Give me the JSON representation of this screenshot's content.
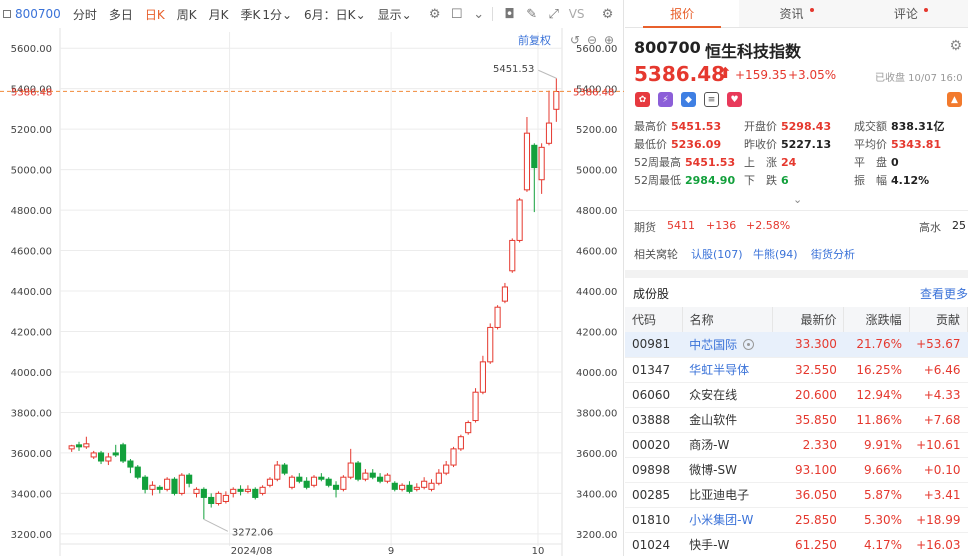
{
  "toolbar": {
    "code": "800700",
    "periods": [
      "分时",
      "多日",
      "日K",
      "周K",
      "月K",
      "季K"
    ],
    "active_period": "日K",
    "minute_select": "1分",
    "range_select": "6月：日K",
    "display_select": "显示",
    "vs_label": "VS"
  },
  "chart": {
    "adjust_label": "前复权",
    "price_line_label": "5386.48",
    "high_annotation": "5451.53",
    "low_annotation": "3272.06",
    "y_ticks": [
      "5600.00",
      "5400.00",
      "5200.00",
      "5000.00",
      "4800.00",
      "4600.00",
      "4400.00",
      "4200.00",
      "4000.00",
      "3800.00",
      "3600.00",
      "3400.00",
      "3200.00"
    ],
    "x_ticks": [
      "2024/08",
      "9",
      "10"
    ],
    "colors": {
      "up": "#e5382e",
      "down": "#13a03c",
      "price_line": "#f08a3a",
      "grid": "#ececec"
    }
  },
  "chart_data": {
    "type": "candlestick",
    "ylim": [
      3140,
      5680
    ],
    "y_ticks": [
      3200,
      3400,
      3600,
      3800,
      4000,
      4200,
      4400,
      4600,
      4800,
      5000,
      5200,
      5400,
      5600
    ],
    "x_ticks": [
      "2024/08",
      "9",
      "10"
    ],
    "last_price": 5386.48,
    "high": 5451.53,
    "low": 3272.06,
    "candles": [
      [
        3620,
        3635,
        3640,
        3605
      ],
      [
        3640,
        3630,
        3655,
        3610
      ],
      [
        3630,
        3645,
        3680,
        3620
      ],
      [
        3580,
        3600,
        3610,
        3570
      ],
      [
        3600,
        3560,
        3610,
        3545
      ],
      [
        3560,
        3580,
        3600,
        3540
      ],
      [
        3600,
        3590,
        3640,
        3580
      ],
      [
        3640,
        3560,
        3650,
        3550
      ],
      [
        3560,
        3530,
        3570,
        3500
      ],
      [
        3530,
        3480,
        3540,
        3470
      ],
      [
        3480,
        3420,
        3490,
        3400
      ],
      [
        3420,
        3440,
        3460,
        3390
      ],
      [
        3430,
        3420,
        3440,
        3400
      ],
      [
        3420,
        3470,
        3480,
        3410
      ],
      [
        3470,
        3400,
        3480,
        3390
      ],
      [
        3400,
        3490,
        3500,
        3390
      ],
      [
        3490,
        3450,
        3500,
        3430
      ],
      [
        3400,
        3420,
        3430,
        3380
      ],
      [
        3420,
        3380,
        3430,
        3272
      ],
      [
        3380,
        3350,
        3400,
        3330
      ],
      [
        3350,
        3400,
        3410,
        3340
      ],
      [
        3360,
        3390,
        3410,
        3350
      ],
      [
        3400,
        3420,
        3430,
        3380
      ],
      [
        3420,
        3410,
        3440,
        3390
      ],
      [
        3410,
        3420,
        3440,
        3400
      ],
      [
        3420,
        3380,
        3430,
        3370
      ],
      [
        3400,
        3430,
        3440,
        3390
      ],
      [
        3440,
        3470,
        3480,
        3430
      ],
      [
        3470,
        3540,
        3560,
        3460
      ],
      [
        3540,
        3500,
        3550,
        3490
      ],
      [
        3430,
        3480,
        3490,
        3420
      ],
      [
        3480,
        3460,
        3500,
        3450
      ],
      [
        3460,
        3430,
        3480,
        3420
      ],
      [
        3440,
        3480,
        3490,
        3430
      ],
      [
        3480,
        3470,
        3500,
        3460
      ],
      [
        3470,
        3440,
        3480,
        3430
      ],
      [
        3440,
        3420,
        3460,
        3380
      ],
      [
        3420,
        3480,
        3490,
        3410
      ],
      [
        3480,
        3550,
        3620,
        3470
      ],
      [
        3550,
        3470,
        3560,
        3460
      ],
      [
        3470,
        3500,
        3520,
        3460
      ],
      [
        3500,
        3480,
        3520,
        3470
      ],
      [
        3480,
        3460,
        3500,
        3450
      ],
      [
        3460,
        3490,
        3500,
        3450
      ],
      [
        3450,
        3420,
        3460,
        3410
      ],
      [
        3420,
        3440,
        3450,
        3410
      ],
      [
        3440,
        3410,
        3460,
        3400
      ],
      [
        3420,
        3430,
        3450,
        3410
      ],
      [
        3430,
        3460,
        3480,
        3420
      ],
      [
        3420,
        3450,
        3470,
        3410
      ],
      [
        3450,
        3500,
        3520,
        3440
      ],
      [
        3500,
        3540,
        3560,
        3490
      ],
      [
        3540,
        3620,
        3630,
        3530
      ],
      [
        3620,
        3680,
        3690,
        3610
      ],
      [
        3700,
        3750,
        3760,
        3690
      ],
      [
        3760,
        3900,
        3920,
        3750
      ],
      [
        3900,
        4050,
        4080,
        3890
      ],
      [
        4050,
        4220,
        4240,
        4040
      ],
      [
        4220,
        4320,
        4330,
        4210
      ],
      [
        4350,
        4420,
        4440,
        4340
      ],
      [
        4500,
        4650,
        4660,
        4490
      ],
      [
        4650,
        4850,
        4860,
        4640
      ],
      [
        4900,
        5180,
        5260,
        4890
      ],
      [
        5120,
        5010,
        5130,
        4790
      ],
      [
        4950,
        5110,
        5130,
        4880
      ],
      [
        5130,
        5230,
        5390,
        5120
      ],
      [
        5298,
        5386,
        5451,
        5236
      ]
    ]
  },
  "tabs": [
    {
      "label": "报价",
      "dot": false
    },
    {
      "label": "资讯",
      "dot": true
    },
    {
      "label": "评论",
      "dot": true
    }
  ],
  "quote": {
    "code": "800700",
    "name": "恒生科技指数",
    "price": "5386.48",
    "change": "+159.35",
    "change_pct": "+3.05%",
    "status": "已收盘 10/07 16:0"
  },
  "stats": {
    "high_label": "最高价",
    "high": "5451.53",
    "open_label": "开盘价",
    "open": "5298.43",
    "turnover_label": "成交额",
    "turnover": "838.31亿",
    "low_label": "最低价",
    "low": "5236.09",
    "prev_label": "昨收价",
    "prev": "5227.13",
    "avg_label": "平均价",
    "avg": "5343.81",
    "w52h_label": "52周最高",
    "w52h": "5451.53",
    "up_label": "上　涨",
    "up": "24",
    "flat_label": "平　盘",
    "flat": "0",
    "w52l_label": "52周最低",
    "w52l": "2984.90",
    "down_label": "下　跌",
    "down": "6",
    "amp_label": "振　幅",
    "amp": "4.12%"
  },
  "futures": {
    "label": "期货",
    "value": "5411",
    "change": "+136",
    "pct": "+2.58%",
    "right": "高水",
    "right_val": "25"
  },
  "related": {
    "label": "相关窝轮",
    "a": "认股(107)",
    "b": "牛熊(94)",
    "c": "街货分析"
  },
  "constituents": {
    "title": "成份股",
    "more": "查看更多",
    "headers": [
      "代码",
      "名称",
      "最新价",
      "涨跌幅",
      "贡献"
    ],
    "rows": [
      {
        "code": "00981",
        "name": "中芯国际",
        "price": "33.300",
        "pct": "21.76%",
        "contrib": "+53.67",
        "link": true,
        "selected": true
      },
      {
        "code": "01347",
        "name": "华虹半导体",
        "price": "32.550",
        "pct": "16.25%",
        "contrib": "+6.46",
        "link": true,
        "selected": false
      },
      {
        "code": "06060",
        "name": "众安在线",
        "price": "20.600",
        "pct": "12.94%",
        "contrib": "+4.33",
        "link": false,
        "selected": false
      },
      {
        "code": "03888",
        "name": "金山软件",
        "price": "35.850",
        "pct": "11.86%",
        "contrib": "+7.68",
        "link": false,
        "selected": false
      },
      {
        "code": "00020",
        "name": "商汤-W",
        "price": "2.330",
        "pct": "9.91%",
        "contrib": "+10.61",
        "link": false,
        "selected": false
      },
      {
        "code": "09898",
        "name": "微博-SW",
        "price": "93.100",
        "pct": "9.66%",
        "contrib": "+0.10",
        "link": false,
        "selected": false
      },
      {
        "code": "00285",
        "name": "比亚迪电子",
        "price": "36.050",
        "pct": "5.87%",
        "contrib": "+3.41",
        "link": false,
        "selected": false
      },
      {
        "code": "01810",
        "name": "小米集团-W",
        "price": "25.850",
        "pct": "5.30%",
        "contrib": "+18.99",
        "link": true,
        "selected": false
      },
      {
        "code": "01024",
        "name": "快手-W",
        "price": "61.250",
        "pct": "4.17%",
        "contrib": "+16.03",
        "link": false,
        "selected": false
      }
    ]
  }
}
